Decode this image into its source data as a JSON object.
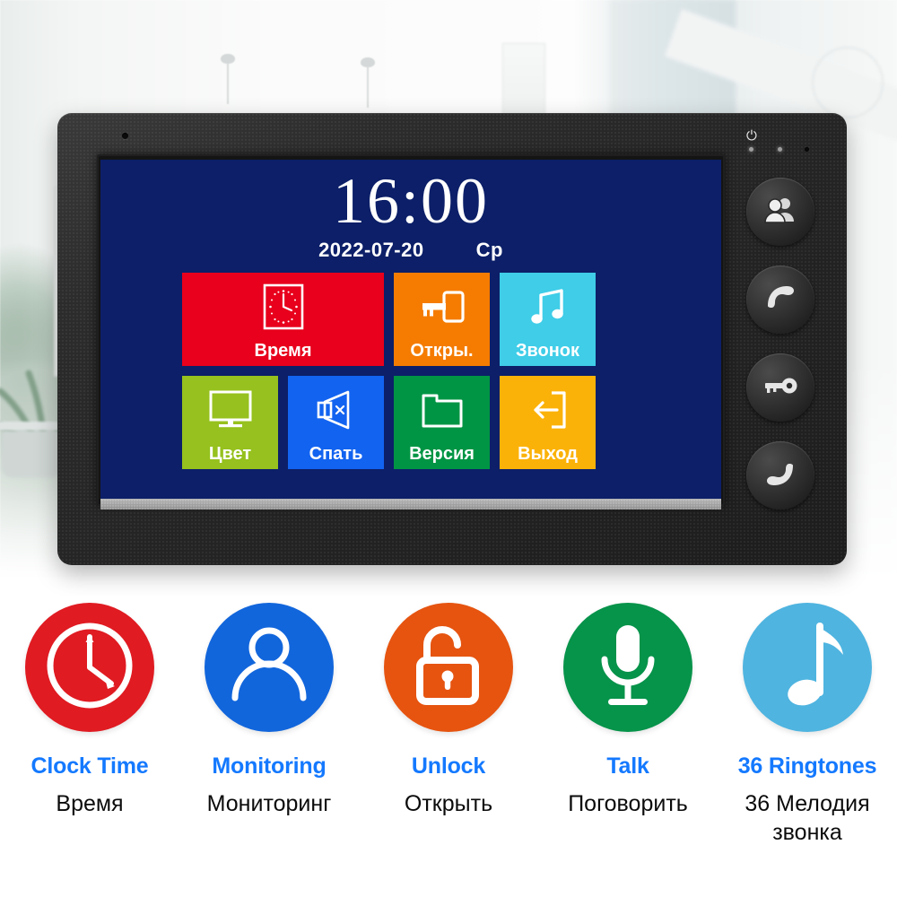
{
  "device": {
    "name": "video-door-phone-monitor",
    "mic_hole": "mic-hole",
    "power_glyph": "⏻",
    "screen": {
      "background_color": "#0c1f68",
      "clock": {
        "time": "16:00",
        "date": "2022-07-20",
        "weekday": "Ср"
      },
      "tiles": [
        {
          "label": "Время",
          "icon": "clock-icon",
          "color": "#E8001C",
          "wide": true
        },
        {
          "label": "Откры.",
          "icon": "key-icon",
          "color": "#F57C00",
          "wide": false
        },
        {
          "label": "Звонок",
          "icon": "music-icon",
          "color": "#3FCDE8",
          "wide": false
        },
        {
          "label": "Цвет",
          "icon": "monitor-icon",
          "color": "#96C11E",
          "wide": false
        },
        {
          "label": "Спать",
          "icon": "mute-icon",
          "color": "#1263F0",
          "wide": false
        },
        {
          "label": "Версия",
          "icon": "folder-icon",
          "color": "#009544",
          "wide": false
        },
        {
          "label": "Выход",
          "icon": "exit-icon",
          "color": "#FBB208",
          "wide": false
        }
      ]
    },
    "side_buttons": [
      {
        "name": "monitor-button",
        "icon": "two-people-icon"
      },
      {
        "name": "talk-button",
        "icon": "handset-up-icon"
      },
      {
        "name": "unlock-button",
        "icon": "key-icon"
      },
      {
        "name": "hangup-button",
        "icon": "handset-down-icon"
      }
    ]
  },
  "features": [
    {
      "icon": "clock-icon",
      "circle_color": "#E01B22",
      "en": "Clock Time",
      "ru": "Время"
    },
    {
      "icon": "person-icon",
      "circle_color": "#1266DC",
      "en": "Monitoring",
      "ru": "Мониторинг"
    },
    {
      "icon": "open-lock-icon",
      "circle_color": "#E65410",
      "en": "Unlock",
      "ru": "Открыть"
    },
    {
      "icon": "microphone-icon",
      "circle_color": "#06934A",
      "en": "Talk",
      "ru": "Поговорить"
    },
    {
      "icon": "music-note-icon",
      "circle_color": "#4FB4E0",
      "en": "36 Ringtones",
      "ru": "36 Мелодия звонка"
    }
  ],
  "colors": {
    "accent_blue": "#1479ff",
    "screen_navy": "#0c1f68",
    "device_black": "#262626"
  }
}
